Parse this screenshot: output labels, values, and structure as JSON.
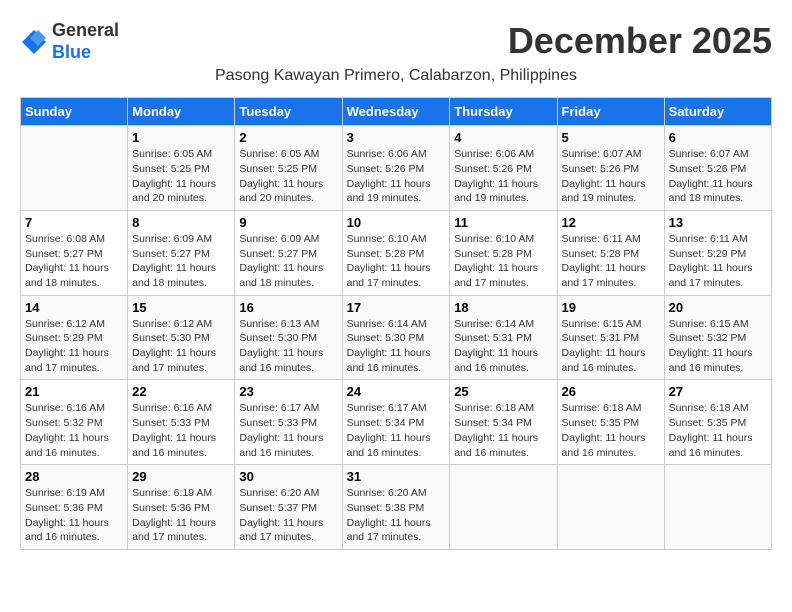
{
  "header": {
    "logo_line1": "General",
    "logo_line2": "Blue",
    "month_title": "December 2025",
    "subtitle": "Pasong Kawayan Primero, Calabarzon, Philippines"
  },
  "days_of_week": [
    "Sunday",
    "Monday",
    "Tuesday",
    "Wednesday",
    "Thursday",
    "Friday",
    "Saturday"
  ],
  "weeks": [
    [
      {
        "num": "",
        "info": ""
      },
      {
        "num": "1",
        "info": "Sunrise: 6:05 AM\nSunset: 5:25 PM\nDaylight: 11 hours\nand 20 minutes."
      },
      {
        "num": "2",
        "info": "Sunrise: 6:05 AM\nSunset: 5:25 PM\nDaylight: 11 hours\nand 20 minutes."
      },
      {
        "num": "3",
        "info": "Sunrise: 6:06 AM\nSunset: 5:26 PM\nDaylight: 11 hours\nand 19 minutes."
      },
      {
        "num": "4",
        "info": "Sunrise: 6:06 AM\nSunset: 5:26 PM\nDaylight: 11 hours\nand 19 minutes."
      },
      {
        "num": "5",
        "info": "Sunrise: 6:07 AM\nSunset: 5:26 PM\nDaylight: 11 hours\nand 19 minutes."
      },
      {
        "num": "6",
        "info": "Sunrise: 6:07 AM\nSunset: 5:26 PM\nDaylight: 11 hours\nand 18 minutes."
      }
    ],
    [
      {
        "num": "7",
        "info": "Sunrise: 6:08 AM\nSunset: 5:27 PM\nDaylight: 11 hours\nand 18 minutes."
      },
      {
        "num": "8",
        "info": "Sunrise: 6:09 AM\nSunset: 5:27 PM\nDaylight: 11 hours\nand 18 minutes."
      },
      {
        "num": "9",
        "info": "Sunrise: 6:09 AM\nSunset: 5:27 PM\nDaylight: 11 hours\nand 18 minutes."
      },
      {
        "num": "10",
        "info": "Sunrise: 6:10 AM\nSunset: 5:28 PM\nDaylight: 11 hours\nand 17 minutes."
      },
      {
        "num": "11",
        "info": "Sunrise: 6:10 AM\nSunset: 5:28 PM\nDaylight: 11 hours\nand 17 minutes."
      },
      {
        "num": "12",
        "info": "Sunrise: 6:11 AM\nSunset: 5:28 PM\nDaylight: 11 hours\nand 17 minutes."
      },
      {
        "num": "13",
        "info": "Sunrise: 6:11 AM\nSunset: 5:29 PM\nDaylight: 11 hours\nand 17 minutes."
      }
    ],
    [
      {
        "num": "14",
        "info": "Sunrise: 6:12 AM\nSunset: 5:29 PM\nDaylight: 11 hours\nand 17 minutes."
      },
      {
        "num": "15",
        "info": "Sunrise: 6:12 AM\nSunset: 5:30 PM\nDaylight: 11 hours\nand 17 minutes."
      },
      {
        "num": "16",
        "info": "Sunrise: 6:13 AM\nSunset: 5:30 PM\nDaylight: 11 hours\nand 16 minutes."
      },
      {
        "num": "17",
        "info": "Sunrise: 6:14 AM\nSunset: 5:30 PM\nDaylight: 11 hours\nand 16 minutes."
      },
      {
        "num": "18",
        "info": "Sunrise: 6:14 AM\nSunset: 5:31 PM\nDaylight: 11 hours\nand 16 minutes."
      },
      {
        "num": "19",
        "info": "Sunrise: 6:15 AM\nSunset: 5:31 PM\nDaylight: 11 hours\nand 16 minutes."
      },
      {
        "num": "20",
        "info": "Sunrise: 6:15 AM\nSunset: 5:32 PM\nDaylight: 11 hours\nand 16 minutes."
      }
    ],
    [
      {
        "num": "21",
        "info": "Sunrise: 6:16 AM\nSunset: 5:32 PM\nDaylight: 11 hours\nand 16 minutes."
      },
      {
        "num": "22",
        "info": "Sunrise: 6:16 AM\nSunset: 5:33 PM\nDaylight: 11 hours\nand 16 minutes."
      },
      {
        "num": "23",
        "info": "Sunrise: 6:17 AM\nSunset: 5:33 PM\nDaylight: 11 hours\nand 16 minutes."
      },
      {
        "num": "24",
        "info": "Sunrise: 6:17 AM\nSunset: 5:34 PM\nDaylight: 11 hours\nand 16 minutes."
      },
      {
        "num": "25",
        "info": "Sunrise: 6:18 AM\nSunset: 5:34 PM\nDaylight: 11 hours\nand 16 minutes."
      },
      {
        "num": "26",
        "info": "Sunrise: 6:18 AM\nSunset: 5:35 PM\nDaylight: 11 hours\nand 16 minutes."
      },
      {
        "num": "27",
        "info": "Sunrise: 6:18 AM\nSunset: 5:35 PM\nDaylight: 11 hours\nand 16 minutes."
      }
    ],
    [
      {
        "num": "28",
        "info": "Sunrise: 6:19 AM\nSunset: 5:36 PM\nDaylight: 11 hours\nand 16 minutes."
      },
      {
        "num": "29",
        "info": "Sunrise: 6:19 AM\nSunset: 5:36 PM\nDaylight: 11 hours\nand 17 minutes."
      },
      {
        "num": "30",
        "info": "Sunrise: 6:20 AM\nSunset: 5:37 PM\nDaylight: 11 hours\nand 17 minutes."
      },
      {
        "num": "31",
        "info": "Sunrise: 6:20 AM\nSunset: 5:38 PM\nDaylight: 11 hours\nand 17 minutes."
      },
      {
        "num": "",
        "info": ""
      },
      {
        "num": "",
        "info": ""
      },
      {
        "num": "",
        "info": ""
      }
    ]
  ]
}
